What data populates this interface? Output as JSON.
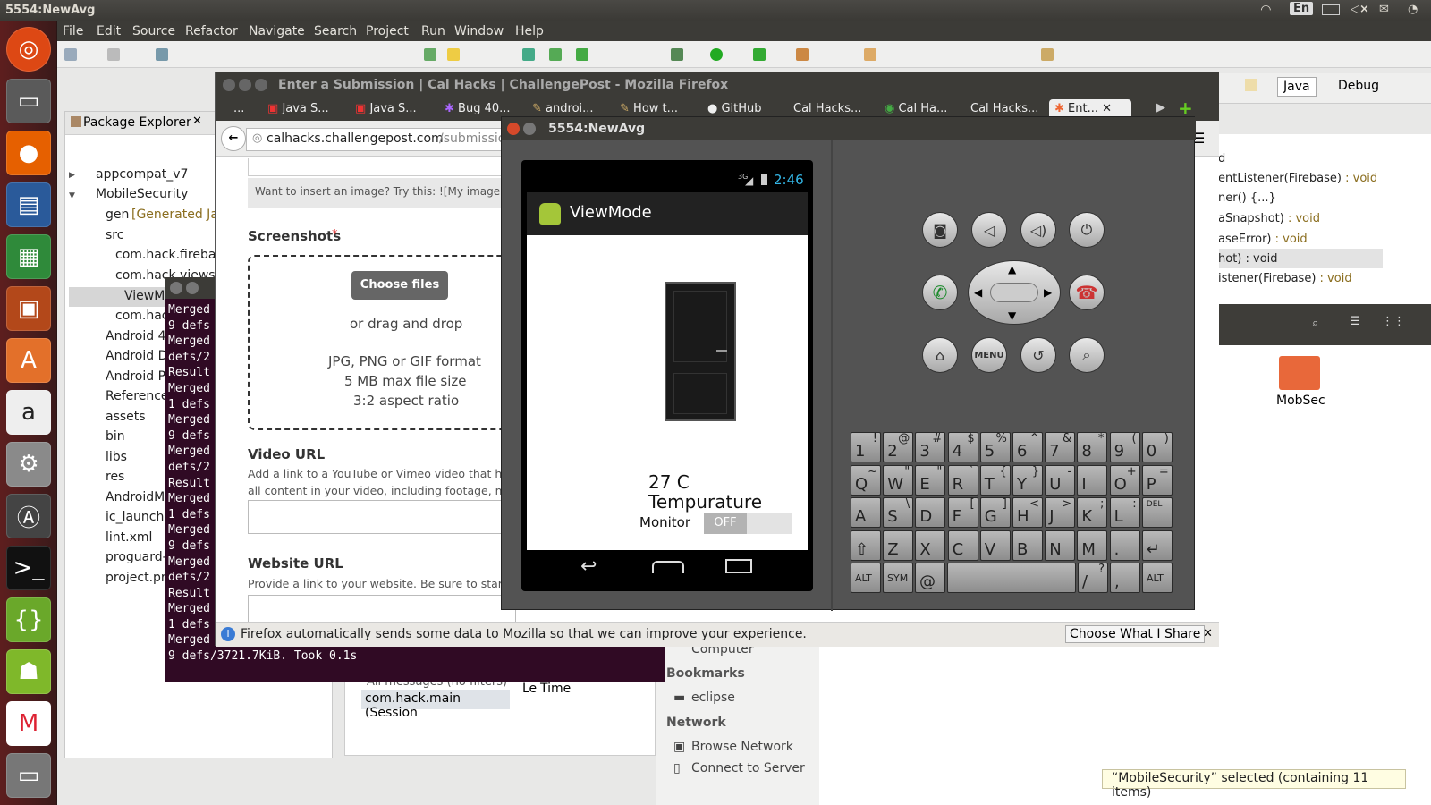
{
  "topbar": {
    "title": "5554:NewAvg",
    "lang": "En"
  },
  "menu": [
    "File",
    "Edit",
    "Source",
    "Refactor",
    "Navigate",
    "Search",
    "Project",
    "Run",
    "Window",
    "Help"
  ],
  "perspective": {
    "java": "Java",
    "debug": "Debug"
  },
  "package_explorer": {
    "title": "Package Explorer",
    "items": [
      "appcompat_v7",
      "MobileSecurity",
      "gen",
      "[Generated Jav",
      "src",
      "com.hack.firebas",
      "com.hack.views",
      "ViewMc",
      "com.hack",
      "Android 4.",
      "Android D",
      "Android Pr",
      "Reference",
      "assets",
      "bin",
      "libs",
      "res",
      "AndroidMa",
      "ic_launche",
      "lint.xml",
      "proguard-",
      "project.pr"
    ]
  },
  "outline": [
    "d",
    "entListener(Firebase)",
    ": void",
    "ner() {...}",
    "aSnapshot)",
    ": void",
    "aseError)",
    ": void",
    "hot) : void",
    "istener(Firebase)",
    ": void"
  ],
  "terminal": {
    "lines": [
      "Merged",
      "9 defs",
      "Merged",
      "defs/2",
      "Result",
      "Merged",
      "1 defs",
      "Merged",
      "9 defs",
      "Merged",
      "defs/2",
      "Result",
      "Merged",
      "1 defs",
      "Merged",
      "9 defs",
      "Merged",
      "defs/2",
      "Result",
      "Merged",
      "1 defs",
      "Merged",
      "9 defs/3721.7KiB. Took 0.1s"
    ]
  },
  "firefox": {
    "title": "Enter a Submission | Cal Hacks | ChallengePost - Mozilla Firefox",
    "tabs": [
      "...",
      "Java S...",
      "Java S...",
      "Bug 40...",
      "androi...",
      "How t...",
      "GitHub",
      "Cal Hacks...",
      "Cal Ha...",
      "Cal Hacks...",
      "Ent..."
    ],
    "url_domain": "calhacks.challengepost.com",
    "url_path": "/submission",
    "image_hint": "Want to insert an image? Try this: ![My image](",
    "screenshots_label": "Screenshots",
    "required_mark": "*",
    "choose_files": "Choose files",
    "drag_drop": "or drag and drop",
    "format": "JPG, PNG or GIF format",
    "size": "5 MB max file size",
    "ratio": "3:2 aspect ratio",
    "video_label": "Video URL",
    "video_desc1": "Add a link to a YouTube or Vimeo video that he",
    "video_desc2": "all content in your video, including footage, musi",
    "website_label": "Website URL",
    "website_desc": "Provide a link to your website. Be sure to start th",
    "notification": "Firefox automatically sends some data to Mozilla so that we can improve your experience.",
    "choose_share": "Choose What I Share"
  },
  "emulator": {
    "title": "5554:NewAvg",
    "time": "2:46",
    "network": "3G",
    "app_title": "ViewMode",
    "temperature": "27 C",
    "temp_label": "Tempurature",
    "monitor_label": "Monitor",
    "toggle_state": "OFF",
    "menu_key": "MENU",
    "keyboard": {
      "row1": [
        [
          "1",
          "!"
        ],
        [
          "2",
          "@"
        ],
        [
          "3",
          "#"
        ],
        [
          "4",
          "$"
        ],
        [
          "5",
          "%"
        ],
        [
          "6",
          "^"
        ],
        [
          "7",
          "&"
        ],
        [
          "8",
          "*"
        ],
        [
          "9",
          "("
        ],
        [
          "0",
          ")"
        ]
      ],
      "row2": [
        [
          "Q",
          "~"
        ],
        [
          "W",
          "\""
        ],
        [
          "E",
          "\""
        ],
        [
          "R",
          "`"
        ],
        [
          "T",
          "{"
        ],
        [
          "Y",
          "}"
        ],
        [
          "U",
          "-"
        ],
        [
          "I",
          ""
        ],
        [
          "O",
          "+"
        ],
        [
          "P",
          "="
        ]
      ],
      "row3": [
        [
          "A",
          ""
        ],
        [
          "S",
          "\\"
        ],
        [
          "D",
          ""
        ],
        [
          "F",
          "["
        ],
        [
          "G",
          "]"
        ],
        [
          "H",
          "<"
        ],
        [
          "J",
          ">"
        ],
        [
          "K",
          ";"
        ],
        [
          "L",
          ":"
        ],
        [
          "DEL",
          ""
        ]
      ],
      "row4": [
        [
          "⇧",
          ""
        ],
        [
          "Z",
          ""
        ],
        [
          "X",
          ""
        ],
        [
          "C",
          ""
        ],
        [
          "V",
          ""
        ],
        [
          "B",
          ""
        ],
        [
          "N",
          ""
        ],
        [
          "M",
          ""
        ],
        [
          ".",
          ""
        ],
        [
          "↵",
          ""
        ]
      ],
      "row5_alt": "ALT",
      "row5_sym": "SYM",
      "row5_at": "@",
      "row5_slash": "/",
      "row5_q": "?",
      "row5_comma": ","
    }
  },
  "nautilus": {
    "computer": "Computer",
    "bookmarks": "Bookmarks",
    "eclipse": "eclipse",
    "network": "Network",
    "browse": "Browse Network",
    "connect": "Connect to Server",
    "folder": "MobSec",
    "status": "“MobileSecurity” selected  (containing 11 items)"
  },
  "console": {
    "filter": "All messages (no filters)",
    "session": "com.hack.main (Session",
    "col_le": "Le",
    "col_time": "Time"
  }
}
